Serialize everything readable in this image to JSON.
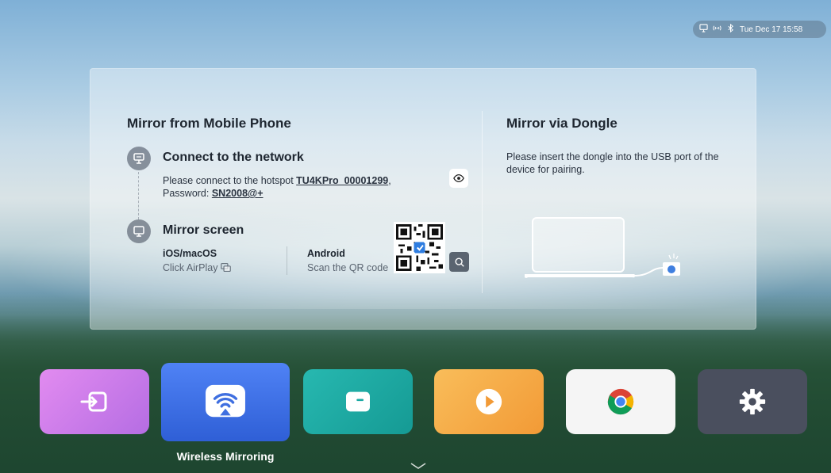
{
  "status_bar": {
    "icons": [
      "network-icon",
      "signal-icon",
      "bluetooth-icon"
    ],
    "datetime": "Tue Dec 17 15:58"
  },
  "left_section": {
    "title": "Mirror from Mobile Phone",
    "step1": {
      "icon": "network-icon",
      "title": "Connect to the network",
      "text_prefix": "Please connect to the hotspot ",
      "hotspot": "TU4KPro_00001299",
      "text_sep": ",",
      "password_label": "Password: ",
      "password": "SN2008@+",
      "reveal_icon": "eye-icon"
    },
    "step2": {
      "icon": "monitor-icon",
      "title": "Mirror screen",
      "ios_label": "iOS/macOS",
      "ios_hint": "Click AirPlay",
      "android_label": "Android",
      "android_hint": "Scan the QR code",
      "zoom_icon": "search-icon"
    }
  },
  "right_section": {
    "title": "Mirror via Dongle",
    "text": "Please insert the dongle into the USB port of the device for pairing."
  },
  "dock": {
    "items": [
      {
        "name": "input-source",
        "icon": "input-icon",
        "color": "#c57be8"
      },
      {
        "name": "wireless-mirroring",
        "icon": "cast-icon",
        "color": "#3f6fe0",
        "label": "Wireless Mirroring",
        "active": true
      },
      {
        "name": "file-manager",
        "icon": "folder-icon",
        "color": "#1aa9a3"
      },
      {
        "name": "media-player",
        "icon": "play-icon",
        "color": "#f4aa45"
      },
      {
        "name": "chrome",
        "icon": "chrome-icon",
        "color": "#f5f5f5"
      },
      {
        "name": "settings",
        "icon": "gear-icon",
        "color": "#4a4f5e"
      }
    ]
  },
  "colors": {
    "accent": "#3f6fe0"
  }
}
